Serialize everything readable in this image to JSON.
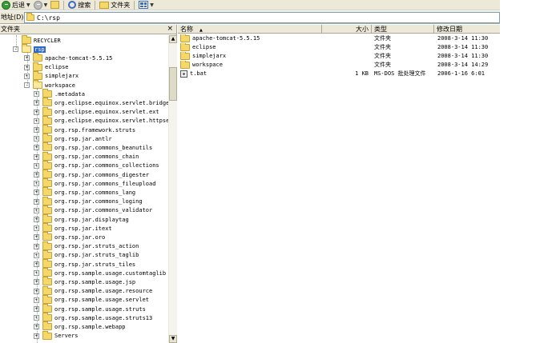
{
  "toolbar": {
    "back_label": "后退",
    "search_label": "搜索",
    "folders_label": "文件夹"
  },
  "address": {
    "label": "地址(D)",
    "value": "C:\\rsp"
  },
  "folder_pane": {
    "title": "文件夹",
    "close_glyph": "×",
    "tree": [
      {
        "label": "RECYCLER",
        "expander": "none",
        "selected": false
      },
      {
        "label": "rsp",
        "expander": "-",
        "selected": true
      },
      {
        "label": "apache-tomcat-5.5.15",
        "expander": "+",
        "selected": false
      },
      {
        "label": "eclipse",
        "expander": "+",
        "selected": false
      },
      {
        "label": "simplejarx",
        "expander": "+",
        "selected": false
      },
      {
        "label": "workspace",
        "expander": "-",
        "selected": false
      },
      {
        "label": ".metadata",
        "expander": "+",
        "selected": false
      },
      {
        "label": "org.eclipse.equinox.servlet.bridge",
        "expander": "+",
        "selected": false
      },
      {
        "label": "org.eclipse.equinox.servlet.ext",
        "expander": "+",
        "selected": false
      },
      {
        "label": "org.eclipse.equinox.servlet.httpserv",
        "expander": "+",
        "selected": false
      },
      {
        "label": "org.rsp.framework.struts",
        "expander": "+",
        "selected": false
      },
      {
        "label": "org.rsp.jar.antlr",
        "expander": "+",
        "selected": false
      },
      {
        "label": "org.rsp.jar.commons_beanutils",
        "expander": "+",
        "selected": false
      },
      {
        "label": "org.rsp.jar.commons_chain",
        "expander": "+",
        "selected": false
      },
      {
        "label": "org.rsp.jar.commons_collections",
        "expander": "+",
        "selected": false
      },
      {
        "label": "org.rsp.jar.commons_digester",
        "expander": "+",
        "selected": false
      },
      {
        "label": "org.rsp.jar.commons_fileupload",
        "expander": "+",
        "selected": false
      },
      {
        "label": "org.rsp.jar.commons_lang",
        "expander": "+",
        "selected": false
      },
      {
        "label": "org.rsp.jar.commons_loging",
        "expander": "+",
        "selected": false
      },
      {
        "label": "org.rsp.jar.commons_validator",
        "expander": "+",
        "selected": false
      },
      {
        "label": "org.rsp.jar.displaytag",
        "expander": "+",
        "selected": false
      },
      {
        "label": "org.rsp.jar.itext",
        "expander": "+",
        "selected": false
      },
      {
        "label": "org.rsp.jar.oro",
        "expander": "+",
        "selected": false
      },
      {
        "label": "org.rsp.jar.struts_action",
        "expander": "+",
        "selected": false
      },
      {
        "label": "org.rsp.jar.struts_taglib",
        "expander": "+",
        "selected": false
      },
      {
        "label": "org.rsp.jar.struts_tiles",
        "expander": "+",
        "selected": false
      },
      {
        "label": "org.rsp.sample.usage.customtaglib",
        "expander": "+",
        "selected": false
      },
      {
        "label": "org.rsp.sample.usage.jsp",
        "expander": "+",
        "selected": false
      },
      {
        "label": "org.rsp.sample.usage.resource",
        "expander": "+",
        "selected": false
      },
      {
        "label": "org.rsp.sample.usage.servlet",
        "expander": "+",
        "selected": false
      },
      {
        "label": "org.rsp.sample.usage.struts",
        "expander": "+",
        "selected": false
      },
      {
        "label": "org.rsp.sample.usage.struts13",
        "expander": "+",
        "selected": false
      },
      {
        "label": "org.rsp.sample.webapp",
        "expander": "+",
        "selected": false
      },
      {
        "label": "Servers",
        "expander": "+",
        "selected": false
      }
    ]
  },
  "file_list": {
    "columns": {
      "name": "名称",
      "size": "大小",
      "type": "类型",
      "modified": "修改日期",
      "sort_glyph": "▲"
    },
    "rows": [
      {
        "icon": "folder-icon",
        "name": "apache-tomcat-5.5.15",
        "size": "",
        "type": "文件夹",
        "modified": "2008-3-14 11:30"
      },
      {
        "icon": "folder-icon",
        "name": "eclipse",
        "size": "",
        "type": "文件夹",
        "modified": "2008-3-14 11:30"
      },
      {
        "icon": "folder-icon",
        "name": "simplejarx",
        "size": "",
        "type": "文件夹",
        "modified": "2008-3-14 11:30"
      },
      {
        "icon": "folder-icon",
        "name": "workspace",
        "size": "",
        "type": "文件夹",
        "modified": "2008-3-14 14:29"
      },
      {
        "icon": "batch-file-icon",
        "name": "t.bat",
        "size": "1 KB",
        "type": "MS-DOS 批处理文件",
        "modified": "2006-1-16 6:01"
      }
    ]
  }
}
